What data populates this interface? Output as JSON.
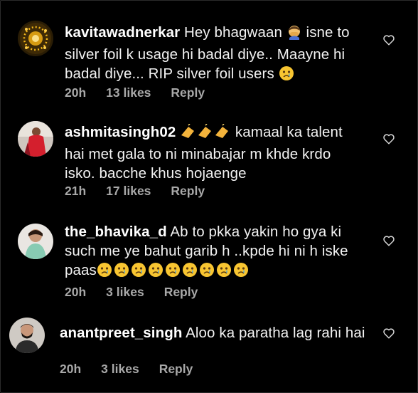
{
  "comments": [
    {
      "username": "kavitawadnerkar",
      "text_a": " Hey bhagwaan ",
      "text_b": " isne to silver foil k usage hi badal diye.. Maayne hi badal diye... RIP silver foil users ",
      "time": "20h",
      "likes": "13 likes",
      "reply": "Reply",
      "emoji_a": "face-palm-emoji",
      "emoji_b": "crying-face-emoji"
    },
    {
      "username": "ashmitasingh02",
      "text_a": " ",
      "text_b": " kamaal ka talent hai met gala to ni minabajar m khde krdo isko. bacche khus hojaenge",
      "time": "21h",
      "likes": "17 likes",
      "reply": "Reply",
      "emoji_a": "clapping-hands-emoji"
    },
    {
      "username": "the_bhavika_d",
      "text_a": " Ab to pkka yakin ho gya ki such me ye bahut garib h ..kpde hi ni h iske paas",
      "time": "20h",
      "likes": "3 likes",
      "reply": "Reply",
      "emoji_a": "crying-face-emoji"
    },
    {
      "username": "anantpreet_singh",
      "text_a": " Aloo ka paratha lag rahi hai",
      "time": "20h",
      "likes": "3 likes",
      "reply": "Reply"
    }
  ],
  "icons": {
    "like": "heart-outline-icon"
  },
  "colors": {
    "background": "#000000",
    "text": "#f2f2f2",
    "meta": "#a8a8a8"
  }
}
